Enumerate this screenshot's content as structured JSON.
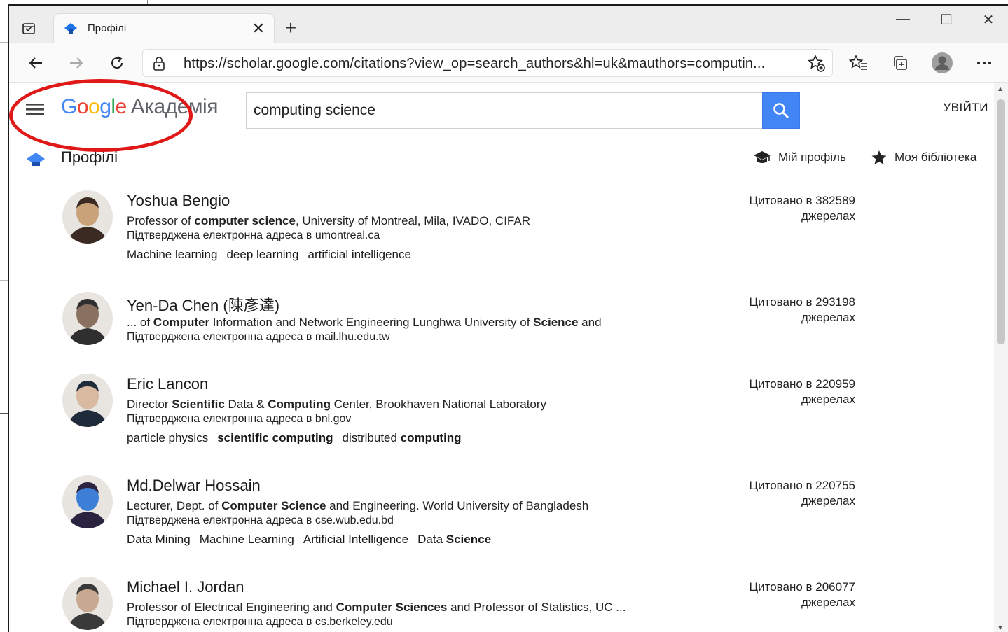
{
  "browser": {
    "tab_title": "Профілі",
    "new_tab": "+",
    "tab_close": "✕",
    "url": "https://scholar.google.com/citations?view_op=search_authors&hl=uk&mauthors=computin...",
    "window_controls": [
      "—",
      "☐",
      "✕"
    ],
    "icons": [
      "tab-actions-icon",
      "back-icon",
      "forward-icon",
      "refresh-icon",
      "lock-icon",
      "add-favorite-icon",
      "favorites-icon",
      "collections-icon",
      "profile-icon",
      "more-icon"
    ]
  },
  "scholar": {
    "logo_letters": [
      "G",
      "o",
      "o",
      "g",
      "l",
      "e"
    ],
    "logo_suffix": "Академія",
    "search_value": "computing science",
    "signin_label": "УВІЙТИ",
    "page_title": "Профілі",
    "my_profile_label": "Мій профіль",
    "my_library_label": "Моя бібліотека"
  },
  "profiles": [
    {
      "name": "Yoshua Bengio",
      "affiliation_parts": [
        {
          "text": "Professor of ",
          "bold": false
        },
        {
          "text": "computer science",
          "bold": true
        },
        {
          "text": ", University of Montreal, Mila, IVADO, CIFAR",
          "bold": false
        }
      ],
      "email": "Підтверджена електронна адреса в umontreal.ca",
      "tags": [
        [
          {
            "text": "Machine learning",
            "bold": false
          }
        ],
        [
          {
            "text": "deep learning",
            "bold": false
          }
        ],
        [
          {
            "text": "artificial intelligence",
            "bold": false
          }
        ]
      ],
      "cited_line1": "Цитовано в 382589",
      "cited_line2": "джерелах",
      "avatar_colors": [
        "#c9a27a",
        "#3a2a22"
      ]
    },
    {
      "name": "Yen-Da Chen (陳彥達)",
      "affiliation_parts": [
        {
          "text": "... of ",
          "bold": false
        },
        {
          "text": "Computer",
          "bold": true
        },
        {
          "text": " Information and Network Engineering Lunghwa University of ",
          "bold": false
        },
        {
          "text": "Science",
          "bold": true
        },
        {
          "text": " and",
          "bold": false
        }
      ],
      "email": "Підтверджена електронна адреса в mail.lhu.edu.tw",
      "tags": [],
      "cited_line1": "Цитовано в 293198",
      "cited_line2": "джерелах",
      "avatar_colors": [
        "#8a7060",
        "#2f2f2f"
      ]
    },
    {
      "name": "Eric Lancon",
      "affiliation_parts": [
        {
          "text": "Director ",
          "bold": false
        },
        {
          "text": "Scientific",
          "bold": true
        },
        {
          "text": " Data & ",
          "bold": false
        },
        {
          "text": "Computing",
          "bold": true
        },
        {
          "text": " Center, Brookhaven National Laboratory",
          "bold": false
        }
      ],
      "email": "Підтверджена електронна адреса в bnl.gov",
      "tags": [
        [
          {
            "text": "particle physics",
            "bold": false
          }
        ],
        [
          {
            "text": "scientific computing",
            "bold": true
          }
        ],
        [
          {
            "text": "distributed ",
            "bold": false
          },
          {
            "text": "computing",
            "bold": true
          }
        ]
      ],
      "cited_line1": "Цитовано в 220959",
      "cited_line2": "джерелах",
      "avatar_colors": [
        "#d9b9a0",
        "#1f2a3a"
      ]
    },
    {
      "name": "Md.Delwar Hossain",
      "affiliation_parts": [
        {
          "text": "Lecturer, Dept. of ",
          "bold": false
        },
        {
          "text": "Computer Science",
          "bold": true
        },
        {
          "text": " and Engineering. World University of Bangladesh",
          "bold": false
        }
      ],
      "email": "Підтверджена електронна адреса в cse.wub.edu.bd",
      "tags": [
        [
          {
            "text": "Data Mining",
            "bold": false
          }
        ],
        [
          {
            "text": "Machine Learning",
            "bold": false
          }
        ],
        [
          {
            "text": "Artificial Intelligence",
            "bold": false
          }
        ],
        [
          {
            "text": "Data ",
            "bold": false
          },
          {
            "text": "Science",
            "bold": true
          }
        ]
      ],
      "cited_line1": "Цитовано в 220755",
      "cited_line2": "джерелах",
      "avatar_colors": [
        "#3d7fd6",
        "#2a2440"
      ]
    },
    {
      "name": "Michael I. Jordan",
      "affiliation_parts": [
        {
          "text": "Professor of Electrical Engineering and ",
          "bold": false
        },
        {
          "text": "Computer Sciences",
          "bold": true
        },
        {
          "text": " and Professor of Statistics, UC ...",
          "bold": false
        }
      ],
      "email": "Підтверджена електронна адреса в cs.berkeley.edu",
      "tags": [],
      "cited_line1": "Цитовано в 206077",
      "cited_line2": "джерелах",
      "avatar_colors": [
        "#c8a890",
        "#3a3a3a"
      ]
    }
  ],
  "colors": {
    "annotation_ring": "#e01818",
    "search_button": "#4285f4",
    "scholar_cap": "#4285f4"
  }
}
